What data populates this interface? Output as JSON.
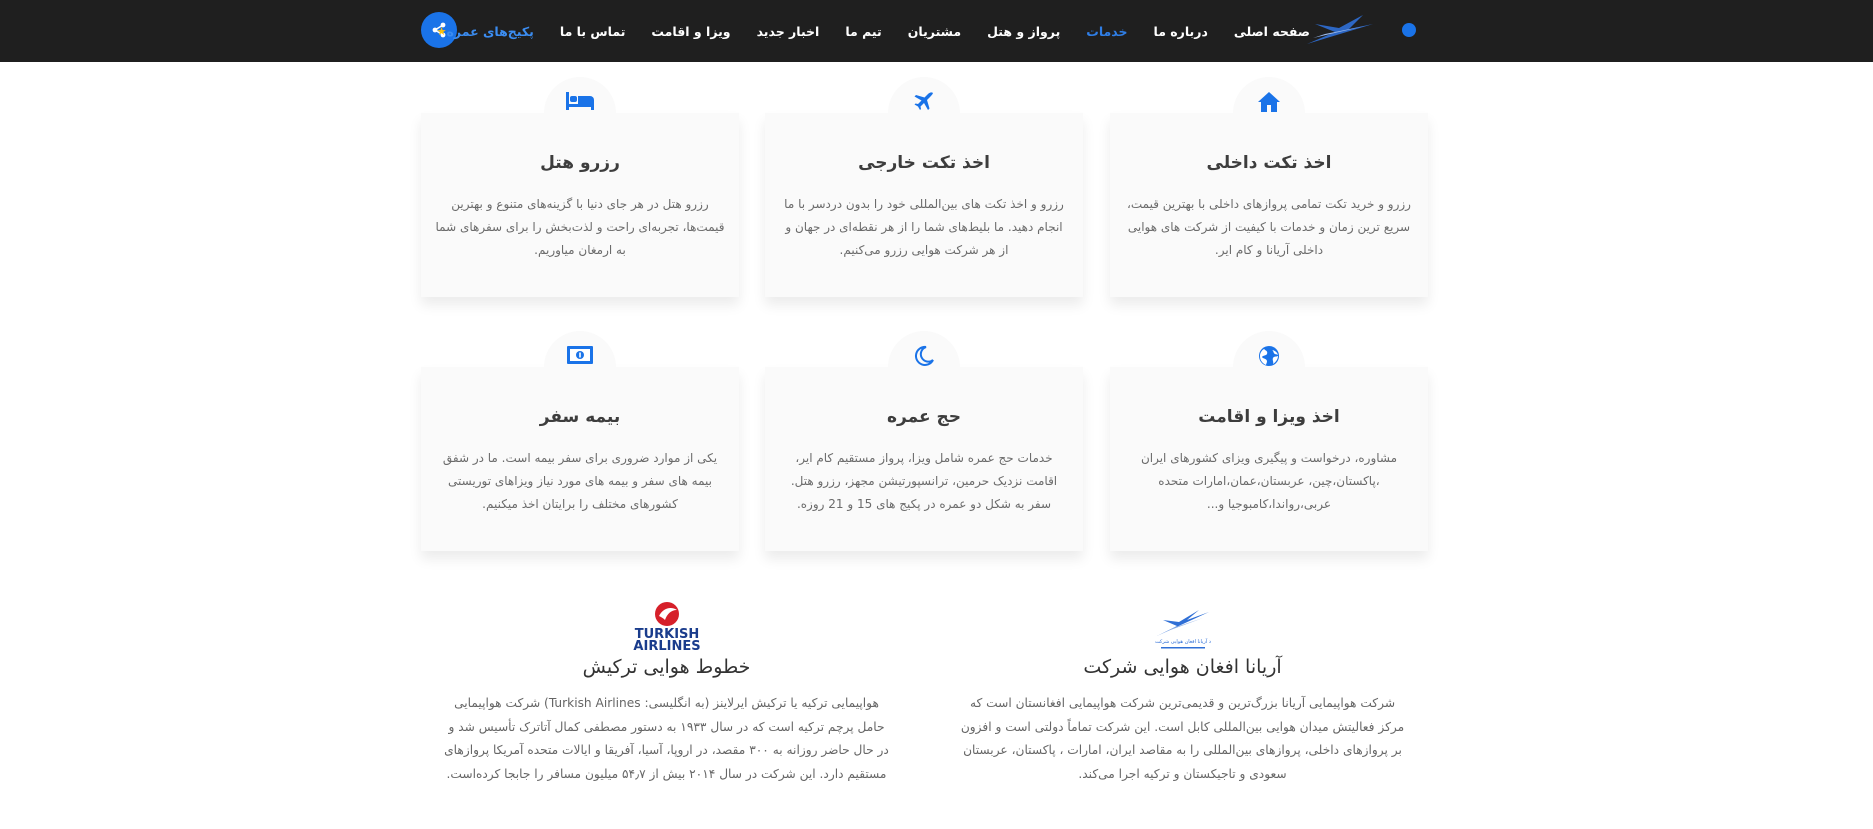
{
  "nav": {
    "items": [
      {
        "label": "صفحه اصلی",
        "state": "normal"
      },
      {
        "label": "درباره ما",
        "state": "normal"
      },
      {
        "label": "خدمات",
        "state": "active"
      },
      {
        "label": "پرواز و هتل",
        "state": "normal"
      },
      {
        "label": "مشتریان",
        "state": "normal"
      },
      {
        "label": "تیم ما",
        "state": "normal"
      },
      {
        "label": "اخبار جدید",
        "state": "normal"
      },
      {
        "label": "ویزا و اقامت",
        "state": "normal"
      },
      {
        "label": "تماس با ما",
        "state": "normal"
      },
      {
        "label": "پکیج‌های عمره",
        "state": "special"
      }
    ],
    "colors": {
      "bar": "#1f1f1f",
      "active": "#2f7ee6",
      "accent": "#1a73e8",
      "star": "#ffc107"
    },
    "share_icon": "share-icon"
  },
  "services": [
    {
      "icon": "home-icon",
      "title": "اخذ تکت داخلی",
      "text": "رزرو و خرید تکت تمامی پروازهای داخلی با بهترین قیمت، سریع ترین زمان و خدمات با کیفیت از شرکت های هوایی داخلی آریانا و کام ایر."
    },
    {
      "icon": "plane-icon",
      "title": "اخذ تکت خارجی",
      "text": "رزرو و اخذ تکت های بین‌المللی خود را بدون دردسر با ما انجام دهید. ما بلیط‌های شما را از هر نقطه‌ای در جهان و از هر شرکت هوایی رزرو می‌کنیم."
    },
    {
      "icon": "bed-icon",
      "title": "رزرو هتل",
      "text": "رزرو هتل در هر جای دنیا با گزینه‌های متنوع و بهترین قیمت‌ها، تجربه‌ای راحت و لذت‌بخش را برای سفرهای شما به ارمغان میاوریم."
    },
    {
      "icon": "globe-icon",
      "title": "اخذ ویزا و اقامت",
      "text": "مشاوره، درخواست و پیگیری ویزای کشورهای ایران ،پاکستان،چین، عربستان،عمان،امارات متحده عربی،رواندا،کامبوجیا و..."
    },
    {
      "icon": "moon-icon",
      "title": "حج عمره",
      "text": "خدمات حج عمره شامل ویزا، پرواز مستقیم کام ایر، اقامت نزدیک حرمین، ترانسپورتیشن مجهز، رزرو هتل. سفر به شکل دو عمره در پکیج های 15 و 21 روزه."
    },
    {
      "icon": "money-icon",
      "title": "بیمه سفر",
      "text": "یکی از موارد ضروری برای سفر بیمه است. ما در شفق بیمه های سفر و بیمه های مورد نیاز ویزاهای توریستی کشورهای مختلف را برایتان اخذ میکنیم."
    }
  ],
  "airlines": [
    {
      "name": "آریانا افغان هوایی شرکت",
      "text": "شرکت هواپیمایی آریانا بزرگ‌ترین و قدیمی‌ترین شرکت هواپیمایی افغانستان است که مرکز فعالیتش میدان هوایی بین‌المللی کابل است. این شرکت تماماً دولتی است و افزون بر پروازهای داخلی، پروازهای بین‌المللی را به مقاصد ایران، امارات ، پاکستان، عربستان سعودی و تاجیکستان و ترکیه اجرا می‌کند.",
      "logo_text": "د آریانا افغان هوایی شرکت"
    },
    {
      "name": "خطوط هوایی ترکیش",
      "text": "هواپیمایی ترکیه یا ترکیش ایرلاینز (به انگلیسی: Turkish Airlines) شرکت هواپیمایی حامل پرچم ترکیه است که در سال ۱۹۳۳ به دستور مصطفی کمال آتاترک تأسیس شد و در حال حاضر روزانه به ۳۰۰ مقصد، در اروپا، آسیا، آفریقا و ایالات متحده آمریکا پروازهای مستقیم دارد. این شرکت در سال ۲۰۱۴ بیش از ۵۴٫۷ میلیون مسافر را جابجا کرده‌است.",
      "logo_text_1": "TURKISH",
      "logo_text_2": "AIRLINES"
    }
  ],
  "colors": {
    "icon": "#1a73e8",
    "card_bg": "#fafafa"
  }
}
